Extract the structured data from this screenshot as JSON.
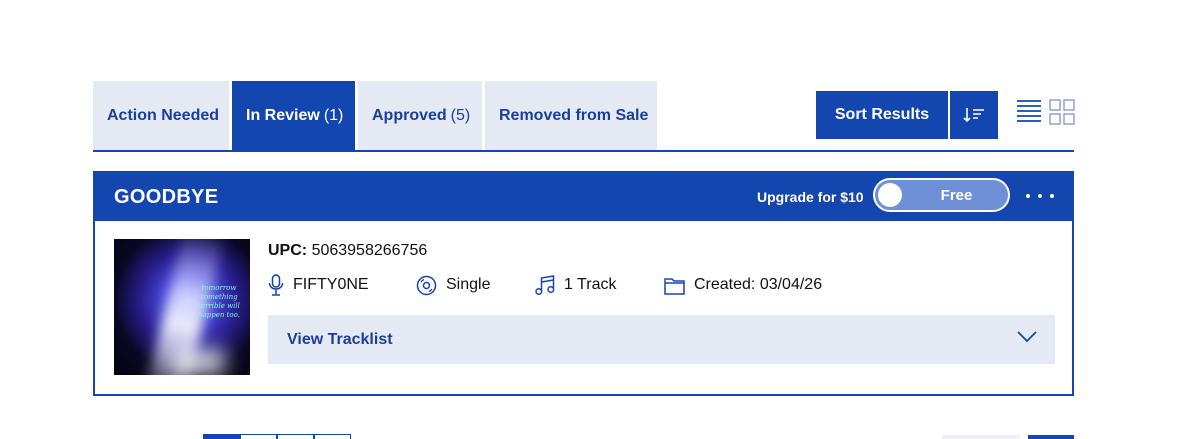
{
  "tabs": [
    {
      "label": "Action Needed",
      "count": ""
    },
    {
      "label": "In Review",
      "count": "(1)"
    },
    {
      "label": "Approved",
      "count": "(5)"
    },
    {
      "label": "Removed from Sale",
      "count": ""
    }
  ],
  "active_tab": "In Review",
  "toolbar": {
    "sort_label": "Sort Results",
    "sort_direction_icon": "sort-descending-icon",
    "view_list_icon": "list-view-icon",
    "view_grid_icon": "grid-view-icon"
  },
  "release": {
    "title": "GOODBYE",
    "upgrade_label": "Upgrade for $10",
    "plan_toggle_label": "Free",
    "cover_text": "tomorrow something terrible will happen too.",
    "upc_label": "UPC:",
    "upc_value": "5063958266756",
    "artist": "FIFTY0NE",
    "type": "Single",
    "tracks": "1 Track",
    "created": "Created: 03/04/26",
    "view_tracklist_label": "View Tracklist"
  },
  "colors": {
    "brand": "#1446b0",
    "tab_bg": "#e4e9f4",
    "toggle_bg": "#6f8fd6"
  }
}
